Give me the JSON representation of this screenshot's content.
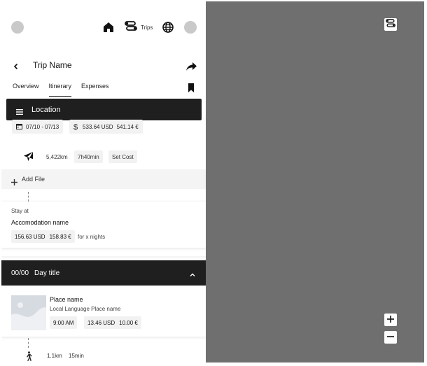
{
  "nav": {
    "trips_label": "Trips"
  },
  "header": {
    "title": "Trip Name"
  },
  "tabs": [
    {
      "label": "Overview",
      "active": false
    },
    {
      "label": "Itinerary",
      "active": true
    },
    {
      "label": "Expenses",
      "active": false
    }
  ],
  "location": {
    "label": "Location",
    "dates": "07/10 - 07/13",
    "cost_usd": "533.64 USD",
    "cost_eur": "541.14 €"
  },
  "flight": {
    "distance": "5,422km",
    "duration": "7h40min",
    "set_cost": "Set Cost"
  },
  "add_file": {
    "label": "Add File"
  },
  "stay": {
    "label": "Stay at",
    "name": "Accomodation name",
    "cost_usd": "156.63 USD",
    "cost_eur": "158.83 €",
    "nights": "for x nights"
  },
  "day": {
    "date": "00/00",
    "title": "Day title"
  },
  "place": {
    "name": "Place name",
    "local_name": "Local Language Place name",
    "time": "9:00 AM",
    "cost_usd": "13.46 USD",
    "cost_eur": "10.00 €"
  },
  "walk": {
    "distance": "1.1km",
    "duration": "15min"
  },
  "colors": {
    "dark_bar": "#1f1f1f",
    "map_bg": "#6f6f6f",
    "chip_bg": "#f2f2f2"
  },
  "icons": [
    "home-icon",
    "route-icon",
    "globe-icon",
    "back-icon",
    "share-icon",
    "bookmark-icon",
    "list-icon",
    "calendar-icon",
    "dollar-icon",
    "plane-icon",
    "plus-icon",
    "chevron-up-icon",
    "walk-icon",
    "minus-icon"
  ]
}
